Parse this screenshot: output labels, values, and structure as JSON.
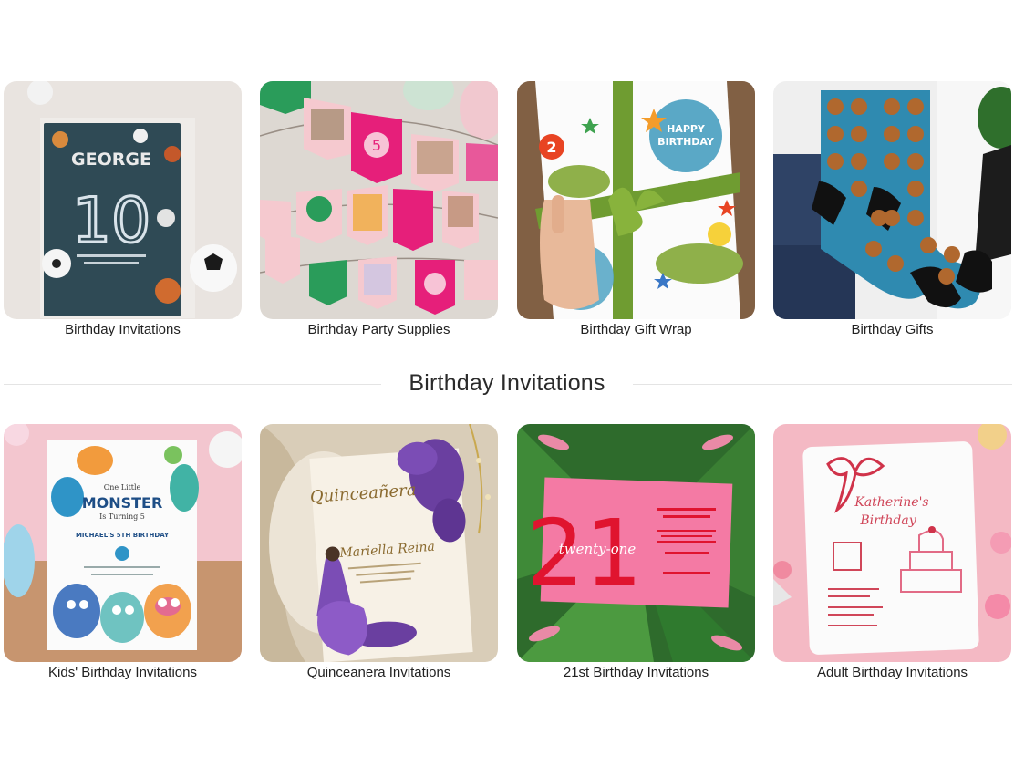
{
  "top_categories": [
    {
      "label": "Birthday Invitations"
    },
    {
      "label": "Birthday Party Supplies"
    },
    {
      "label": "Birthday Gift Wrap"
    },
    {
      "label": "Birthday Gifts"
    }
  ],
  "section": {
    "heading": "Birthday Invitations"
  },
  "invitation_categories": [
    {
      "label": "Kids' Birthday Invitations"
    },
    {
      "label": "Quinceanera Invitations"
    },
    {
      "label": "21st Birthday Invitations"
    },
    {
      "label": "Adult Birthday Invitations"
    }
  ],
  "artwork": {
    "george_card": {
      "name": "GEORGE",
      "number": "10"
    },
    "bunting": {
      "flag_number": "5"
    },
    "gift_wrap": {
      "tag_line1": "HAPPY",
      "tag_line2": "BIRTHDAY",
      "age_badge": "2"
    },
    "monster_card": {
      "line1": "One Little",
      "line2": "MONSTER",
      "line3": "Is Turning 5",
      "line4": "MICHAEL'S 5TH BIRTHDAY"
    },
    "quince_card": {
      "script_title": "Quinceañera",
      "script_name": "Mariella Reina"
    },
    "twenty_one_card": {
      "number": "21",
      "script": "twenty-one"
    },
    "adult_card": {
      "line1": "Katherine's",
      "line2": "Birthday"
    }
  }
}
